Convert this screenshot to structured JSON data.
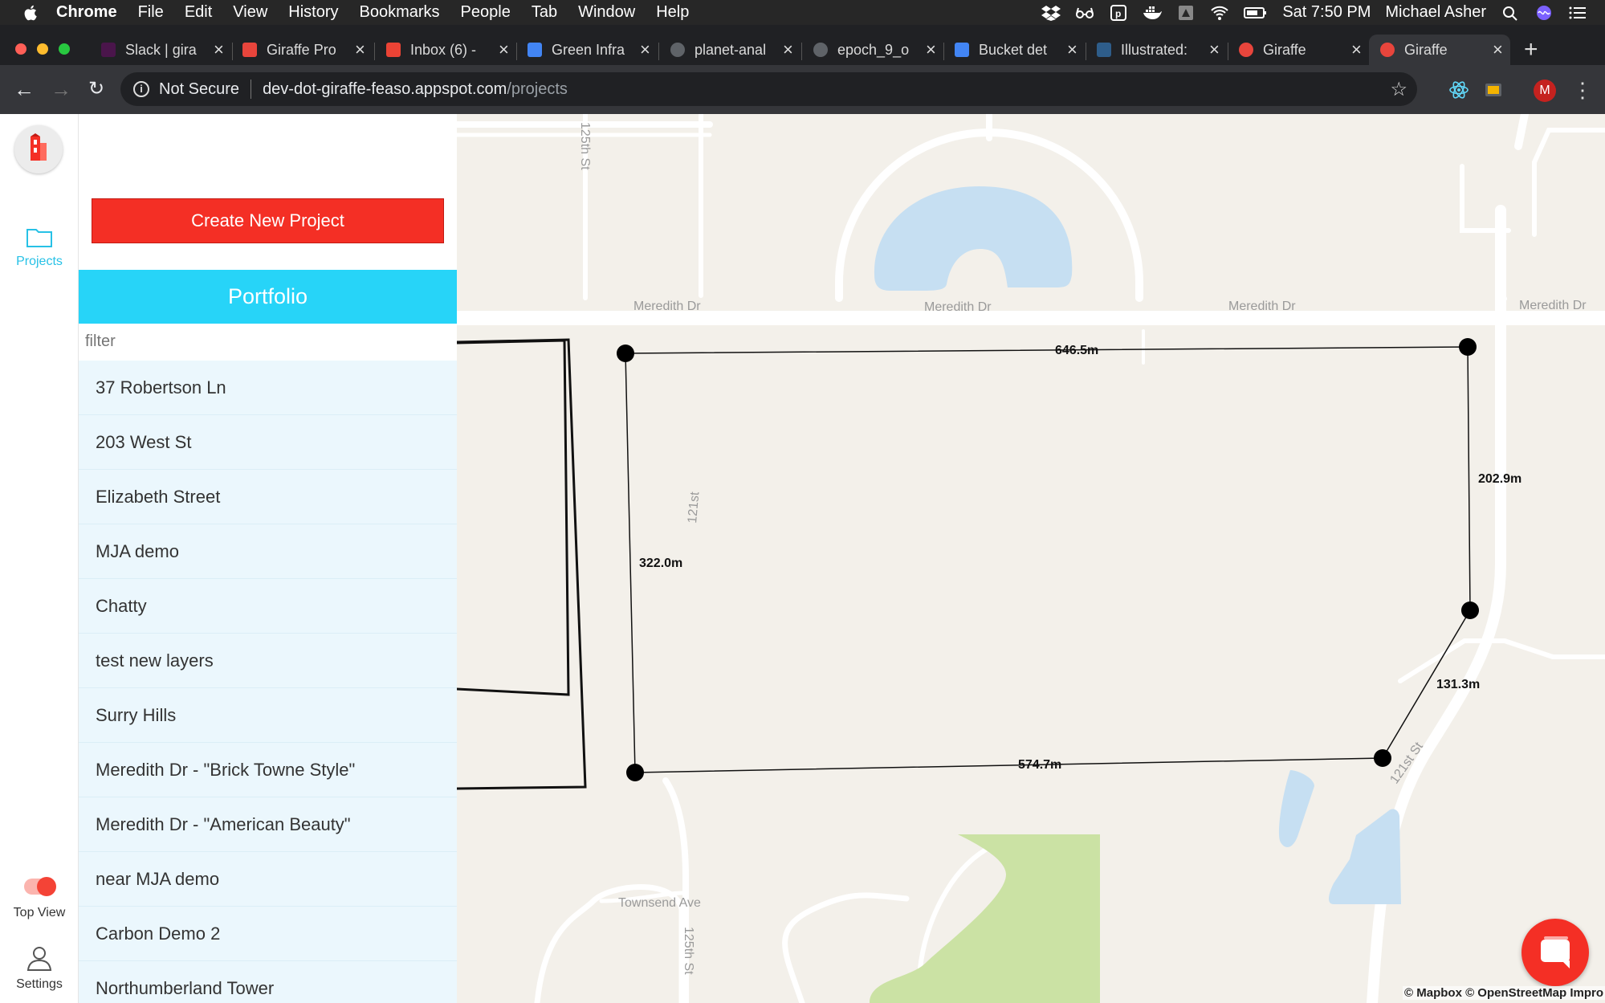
{
  "menubar": {
    "app": "Chrome",
    "items": [
      "File",
      "Edit",
      "View",
      "History",
      "Bookmarks",
      "People",
      "Tab",
      "Window",
      "Help"
    ],
    "clock": "Sat 7:50 PM",
    "user": "Michael Asher"
  },
  "tabs": [
    {
      "title": "Slack | gira",
      "favicon_color": "#4a154b"
    },
    {
      "title": "Giraffe Pro",
      "favicon_color": "#e8453c"
    },
    {
      "title": "Inbox (6) -",
      "favicon_color": "#ea4335"
    },
    {
      "title": "Green Infra",
      "favicon_color": "#4285f4"
    },
    {
      "title": "planet-anal",
      "favicon_color": "#5f6368"
    },
    {
      "title": "epoch_9_o",
      "favicon_color": "#5f6368"
    },
    {
      "title": "Bucket det",
      "favicon_color": "#4285f4"
    },
    {
      "title": "Illustrated:",
      "favicon_color": "#2e5d8a"
    },
    {
      "title": "Giraffe",
      "favicon_color": "#e8453c"
    },
    {
      "title": "Giraffe",
      "favicon_color": "#e8453c",
      "active": true
    }
  ],
  "omnibox": {
    "security": "Not Secure",
    "host": "dev-dot-giraffe-feaso.appspot.com",
    "path": "/projects"
  },
  "profile_initial": "M",
  "rail": {
    "projects_label": "Projects",
    "top_view_label": "Top View",
    "settings_label": "Settings",
    "top_view_on": true
  },
  "panel": {
    "create_button": "Create New Project",
    "portfolio_title": "Portfolio",
    "filter_placeholder": "filter",
    "projects": [
      "37 Robertson Ln",
      "203 West St",
      "Elizabeth Street",
      "MJA demo",
      "Chatty",
      "test new layers",
      "Surry Hills",
      "Meredith Dr - \"Brick Towne Style\"",
      "Meredith Dr - \"American Beauty\"",
      "near MJA demo",
      "Carbon Demo 2",
      "Northumberland Tower"
    ]
  },
  "map": {
    "streets": {
      "meredith": "Meredith Dr",
      "st125": "125th St",
      "st121": "121st",
      "st121b": "121st St",
      "townsend": "Townsend Ave"
    },
    "dimensions": {
      "top": "646.5m",
      "left": "322.0m",
      "right": "202.9m",
      "diag": "131.3m",
      "bottom": "574.7m"
    },
    "attribution": "© Mapbox © OpenStreetMap Impro"
  },
  "colors": {
    "accent_red": "#f42f25",
    "portfolio_cyan": "#27d4f8",
    "list_bg": "#ebf7fd",
    "water": "#c6dff2",
    "park": "#cbe2a4"
  }
}
